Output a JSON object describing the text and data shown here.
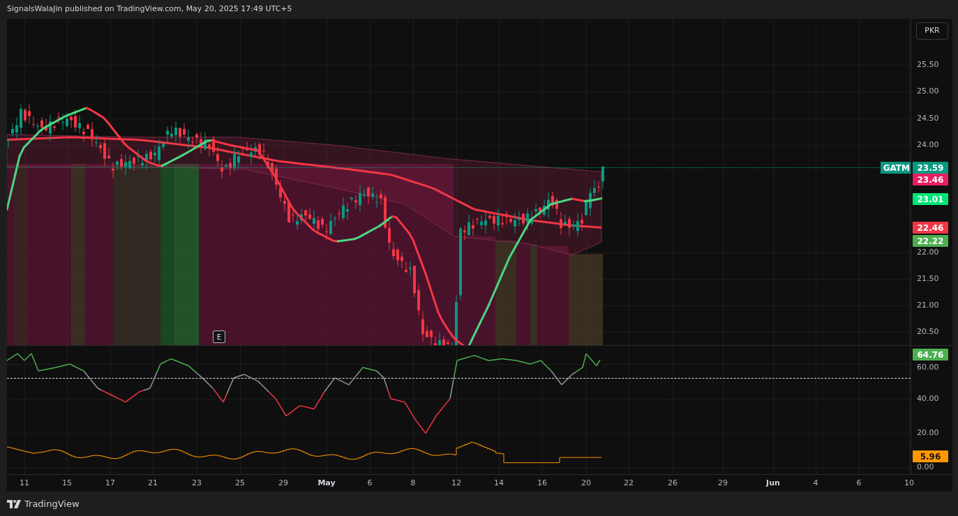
{
  "header": {
    "attribution": "SignalsWalaJin published on TradingView.com, May 20, 2025 17:49 UTC+5"
  },
  "currency_button": "PKR",
  "symbol_label": "GATM",
  "event_marker": "E",
  "price_axis": {
    "ticks": [
      "25.50",
      "25.00",
      "24.50",
      "24.00",
      "22.00",
      "21.50",
      "21.00",
      "20.50"
    ],
    "badges": [
      {
        "value": "23.59",
        "color": "#089981"
      },
      {
        "value": "23.46",
        "color": "#e91e63"
      },
      {
        "value": "23.01",
        "color": "#00e676"
      },
      {
        "value": "22.46",
        "color": "#f23645"
      },
      {
        "value": "22.22",
        "color": "#4caf50"
      }
    ]
  },
  "indicator_axis": {
    "ticks": [
      "60.00",
      "40.00",
      "20.00",
      "0.00"
    ],
    "badges": [
      {
        "value": "64.76",
        "color": "#4caf50"
      },
      {
        "value": "5.96",
        "color": "#ff9800"
      }
    ]
  },
  "time_axis": {
    "labels": [
      {
        "text": "11",
        "kind": "day"
      },
      {
        "text": "15",
        "kind": "day"
      },
      {
        "text": "17",
        "kind": "day"
      },
      {
        "text": "21",
        "kind": "day"
      },
      {
        "text": "23",
        "kind": "day"
      },
      {
        "text": "25",
        "kind": "day"
      },
      {
        "text": "29",
        "kind": "day"
      },
      {
        "text": "May",
        "kind": "month"
      },
      {
        "text": "6",
        "kind": "day"
      },
      {
        "text": "8",
        "kind": "day"
      },
      {
        "text": "12",
        "kind": "day"
      },
      {
        "text": "14",
        "kind": "day"
      },
      {
        "text": "16",
        "kind": "day"
      },
      {
        "text": "20",
        "kind": "day"
      },
      {
        "text": "22",
        "kind": "day"
      },
      {
        "text": "26",
        "kind": "day"
      },
      {
        "text": "29",
        "kind": "day"
      },
      {
        "text": "Jun",
        "kind": "month"
      },
      {
        "text": "4",
        "kind": "day"
      },
      {
        "text": "6",
        "kind": "day"
      },
      {
        "text": "10",
        "kind": "day"
      }
    ]
  },
  "footer": {
    "logo_text": "TradingView"
  }
}
